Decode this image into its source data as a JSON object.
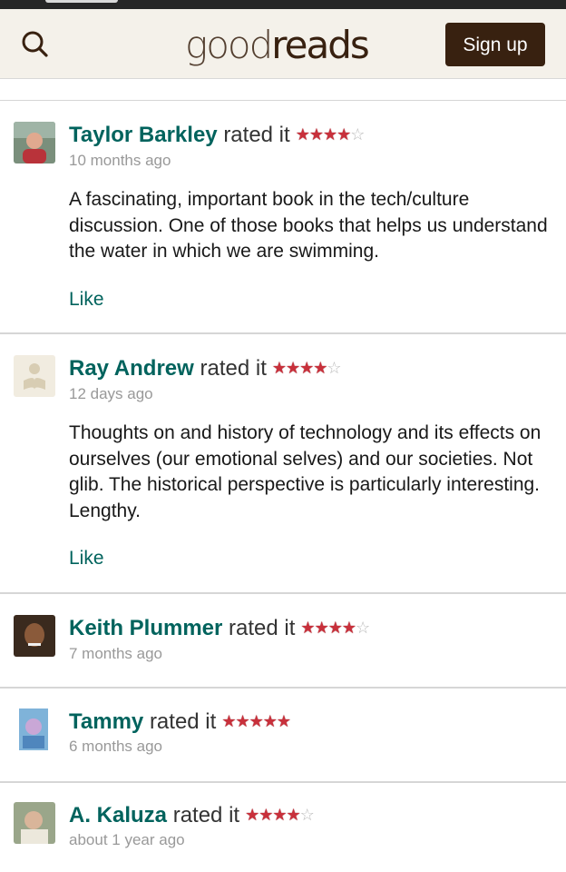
{
  "header": {
    "logo_good": "good",
    "logo_reads": "reads",
    "signup_label": "Sign up"
  },
  "colors": {
    "brand_dark": "#382110",
    "link_green": "#00635d",
    "star_red": "#c8303b",
    "header_bg": "#f4f1ea"
  },
  "icons": {
    "search": "search-icon"
  },
  "reviews": [
    {
      "user": "Taylor Barkley",
      "action": "rated it",
      "rating": 4,
      "date": "10 months ago",
      "text": "A fascinating, important book in the tech/culture discussion. One of those books that helps us understand the water in which we are swimming.",
      "like_label": "Like"
    },
    {
      "user": "Ray Andrew",
      "action": "rated it",
      "rating": 4,
      "date": "12 days ago",
      "text": "Thoughts on and history of technology and its effects on ourselves (our emotional selves) and our societies. Not glib. The historical perspective is particularly interesting. Lengthy.",
      "like_label": "Like"
    },
    {
      "user": "Keith Plummer",
      "action": "rated it",
      "rating": 4,
      "date": "7 months ago"
    },
    {
      "user": "Tammy",
      "action": "rated it",
      "rating": 5,
      "date": "6 months ago"
    },
    {
      "user": "A. Kaluza",
      "action": "rated it",
      "rating": 4,
      "date": "about 1 year ago"
    }
  ]
}
